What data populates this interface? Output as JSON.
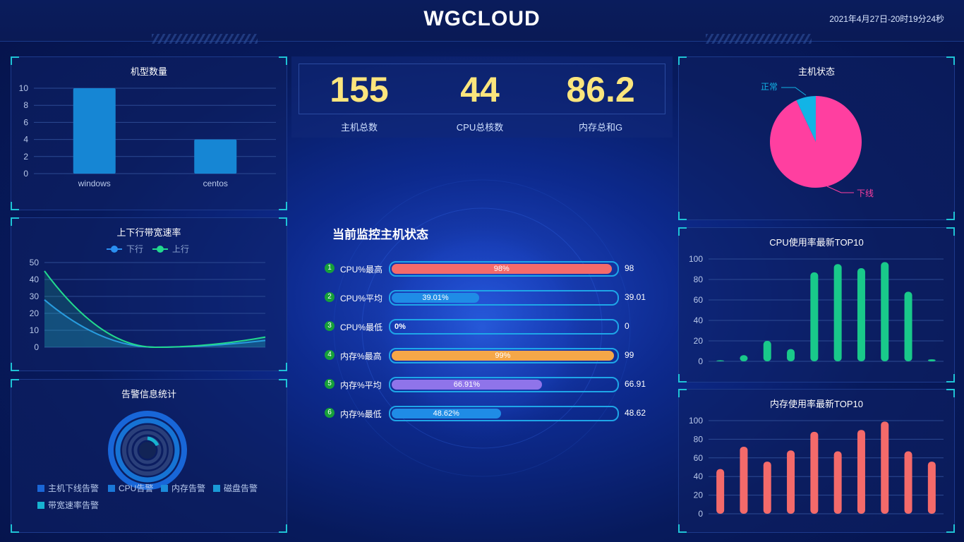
{
  "header": {
    "title": "WGCLOUD",
    "datetime": "2021年4月27日-20时19分24秒"
  },
  "kpis": [
    {
      "value": "155",
      "label": "主机总数"
    },
    {
      "value": "44",
      "label": "CPU总核数"
    },
    {
      "value": "86.2",
      "label": "内存总和G"
    }
  ],
  "status": {
    "title": "当前监控主机状态",
    "rows": [
      {
        "index": "1",
        "label": "CPU%最高",
        "bar_text": "98%",
        "percent": 98,
        "value": "98",
        "color": "#f46a6a"
      },
      {
        "index": "2",
        "label": "CPU%平均",
        "bar_text": "39.01%",
        "percent": 39.01,
        "value": "39.01",
        "color": "#1f8ce6"
      },
      {
        "index": "3",
        "label": "CPU%最低",
        "bar_text": "0%",
        "percent": 0,
        "value": "0",
        "color": "#1f8ce6"
      },
      {
        "index": "4",
        "label": "内存%最高",
        "bar_text": "99%",
        "percent": 99,
        "value": "99",
        "color": "#f5a748"
      },
      {
        "index": "5",
        "label": "内存%平均",
        "bar_text": "66.91%",
        "percent": 66.91,
        "value": "66.91",
        "color": "#8f74ea"
      },
      {
        "index": "6",
        "label": "内存%最低",
        "bar_text": "48.62%",
        "percent": 48.62,
        "value": "48.62",
        "color": "#1f8ce6"
      }
    ]
  },
  "panels": {
    "model_count": {
      "title": "机型数量"
    },
    "bandwidth": {
      "title": "上下行带宽速率"
    },
    "alarm": {
      "title": "告警信息统计"
    },
    "host_status": {
      "title": "主机状态"
    },
    "cpu_top": {
      "title": "CPU使用率最新TOP10"
    },
    "mem_top": {
      "title": "内存使用率最新TOP10"
    }
  },
  "colors": {
    "accent": "#1fc3d6",
    "kpi": "#fbe57d",
    "cpu_bar": "#19c98a",
    "mem_bar": "#f46a6a",
    "offline": "#ff3fa0",
    "online": "#12b4e6"
  },
  "alarm_legend": [
    {
      "label": "主机下线告警",
      "color": "#1a66d6"
    },
    {
      "label": "CPU告警",
      "color": "#1a78d8"
    },
    {
      "label": "内存告警",
      "color": "#1b8ad9"
    },
    {
      "label": "磁盘告警",
      "color": "#1a9ad6"
    },
    {
      "label": "带宽速率告警",
      "color": "#17b3d0"
    }
  ],
  "chart_data": [
    {
      "type": "bar",
      "title": "机型数量",
      "categories": [
        "windows",
        "centos"
      ],
      "values": [
        10,
        4
      ],
      "yticks": [
        0,
        2,
        4,
        6,
        8,
        10
      ],
      "ylim": [
        0,
        10
      ]
    },
    {
      "type": "line",
      "title": "上下行带宽速率",
      "legend": [
        "下行",
        "上行"
      ],
      "yticks": [
        0,
        10,
        20,
        30,
        40,
        50
      ],
      "ylim": [
        0,
        50
      ],
      "series": [
        {
          "name": "下行",
          "values": [
            28,
            0,
            4
          ],
          "color": "#2a8ff0"
        },
        {
          "name": "上行",
          "values": [
            45,
            0,
            6
          ],
          "color": "#22d98e"
        }
      ]
    },
    {
      "type": "pie",
      "title": "主机状态",
      "slices": [
        {
          "label": "正常",
          "value": 7,
          "color": "#12b4e6"
        },
        {
          "label": "下线",
          "value": 93,
          "color": "#ff3fa0"
        }
      ]
    },
    {
      "type": "bar",
      "title": "CPU使用率最新TOP10",
      "values": [
        1,
        6,
        20,
        12,
        87,
        95,
        91,
        97,
        68,
        2
      ],
      "yticks": [
        0,
        20,
        40,
        60,
        80,
        100
      ],
      "ylim": [
        0,
        100
      ]
    },
    {
      "type": "bar",
      "title": "内存使用率最新TOP10",
      "values": [
        48,
        72,
        56,
        68,
        88,
        67,
        90,
        99,
        67,
        56
      ],
      "yticks": [
        0,
        20,
        40,
        60,
        80,
        100
      ],
      "ylim": [
        0,
        100
      ]
    }
  ]
}
